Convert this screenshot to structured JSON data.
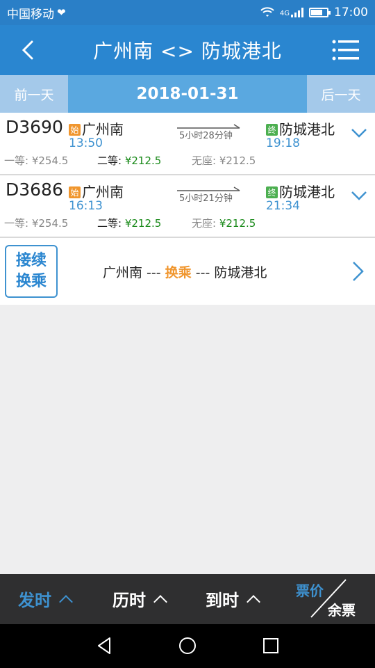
{
  "status_bar": {
    "carrier": "中国移动",
    "network": "4G",
    "time": "17:00"
  },
  "header": {
    "title": "广州南 <> 防城港北",
    "back_icon": "back-chevron-icon",
    "menu_icon": "menu-icon"
  },
  "date_bar": {
    "prev_label": "前一天",
    "date": "2018-01-31",
    "next_label": "后一天"
  },
  "trains": [
    {
      "number": "D3690",
      "start_tag": "始",
      "from": "广州南",
      "depart": "13:50",
      "duration": "5小时28分钟",
      "end_tag": "终",
      "to": "防城港北",
      "arrive": "19:18",
      "first_class_label": "一等:",
      "first_class_price": "¥254.5",
      "second_class_label": "二等:",
      "second_class_price": "¥212.5",
      "no_seat_label": "无座:",
      "no_seat_price": "¥212.5"
    },
    {
      "number": "D3686",
      "start_tag": "始",
      "from": "广州南",
      "depart": "16:13",
      "duration": "5小时21分钟",
      "end_tag": "终",
      "to": "防城港北",
      "arrive": "21:34",
      "first_class_label": "一等:",
      "first_class_price": "¥254.5",
      "second_class_label": "二等:",
      "second_class_price": "¥212.5",
      "no_seat_label": "无座:",
      "no_seat_price": "¥212.5"
    }
  ],
  "transfer": {
    "badge_line1": "接续",
    "badge_line2": "换乘",
    "from": "广州南",
    "sep1": " --- ",
    "middle": "换乘",
    "sep2": " --- ",
    "to": "防城港北"
  },
  "sort_bar": {
    "depart_label": "发时",
    "duration_label": "历时",
    "arrive_label": "到时",
    "price_label": "票价",
    "remaining_label": "余票"
  },
  "colors": {
    "primary": "#2a86d0",
    "accent_orange": "#f0962e",
    "price_green": "#1a8a1a"
  }
}
